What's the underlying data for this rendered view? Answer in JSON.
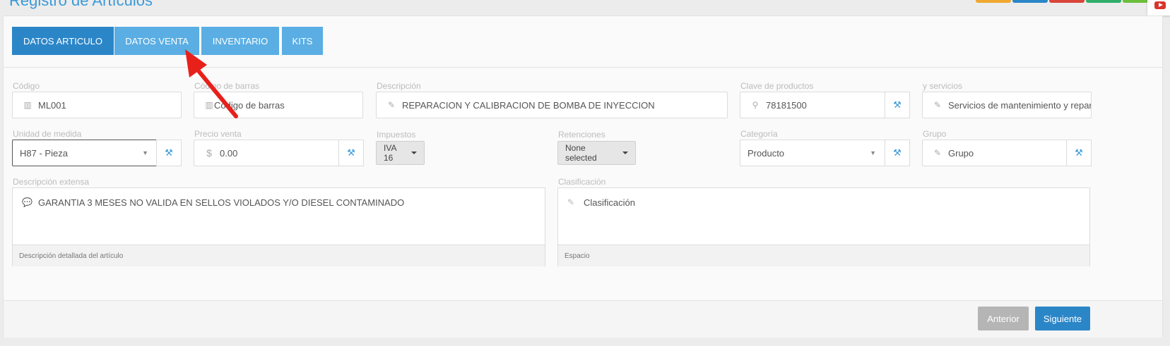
{
  "page_title": "Registro de Artículos",
  "tabs": [
    {
      "label": "DATOS ARTICULO"
    },
    {
      "label": "DATOS VENTA"
    },
    {
      "label": "INVENTARIO"
    },
    {
      "label": "KITS"
    }
  ],
  "fields": {
    "codigo": {
      "label": "Código",
      "value": "ML001",
      "icon": "barcode-icon"
    },
    "codigo_barras": {
      "label": "Código de barras",
      "placeholder": "Código de barras",
      "icon": "barcode-icon"
    },
    "descripcion": {
      "label": "Descripción",
      "value": "REPARACION Y CALIBRACION DE BOMBA DE INYECCION",
      "icon": "edit-icon"
    },
    "clave_productos": {
      "label": "Clave de productos",
      "value": "78181500",
      "icon": "search-icon"
    },
    "servicios": {
      "label": "y servicios",
      "value": "Servicios de mantenimiento y repar",
      "icon": "edit-icon"
    },
    "unidad_medida": {
      "label": "Unidad de medida",
      "value": "H87 - Pieza"
    },
    "precio_venta": {
      "label": "Precio venta",
      "value": "0.00",
      "icon_text": "$"
    },
    "impuestos": {
      "label": "Impuestos",
      "value": "IVA 16"
    },
    "retenciones": {
      "label": "Retenciones",
      "value": "None selected"
    },
    "categoria": {
      "label": "Categoría",
      "value": "Producto"
    },
    "grupo": {
      "label": "Grupo",
      "value": "Grupo",
      "icon": "edit-icon"
    },
    "descripcion_extensa": {
      "label": "Descripción extensa",
      "value": "GARANTIA 3 MESES NO VALIDA EN SELLOS VIOLADOS Y/O DIESEL CONTAMINADO",
      "help": "Descripción detallada del artículo",
      "icon": "comment-icon"
    },
    "clasificacion": {
      "label": "Clasificación",
      "value": "Clasificación",
      "help": "Espacio",
      "icon": "edit-icon"
    }
  },
  "buttons": {
    "anterior": "Anterior",
    "siguiente": "Siguiente"
  },
  "colors": {
    "tab_active": "#2b86c8",
    "tab": "#5aaee3",
    "primary_button": "#2b86c8",
    "disabled_button": "#b5b5b5",
    "annotation_arrow": "#e8201a"
  }
}
